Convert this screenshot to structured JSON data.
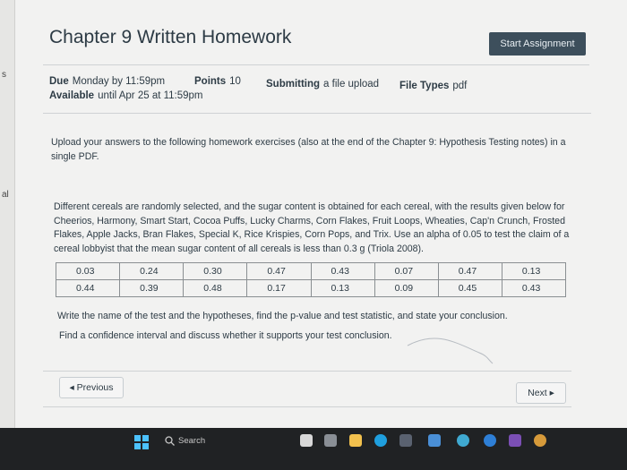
{
  "page": {
    "title": "Chapter 9 Written Homework",
    "start_button": "Start Assignment"
  },
  "rail": {
    "marks": [
      "s",
      "al"
    ]
  },
  "meta": {
    "due_label": "Due",
    "due_value": "Monday by 11:59pm",
    "points_label": "Points",
    "points_value": "10",
    "submitting_label": "Submitting",
    "submitting_value": "a file upload",
    "filetypes_label": "File Types",
    "filetypes_value": "pdf",
    "available_label": "Available",
    "available_value": "until Apr 25 at 11:59pm"
  },
  "instructions": "Upload your answers to the following homework exercises (also at the end of the Chapter 9: Hypothesis Testing notes) in a single PDF.",
  "problem": "Different cereals are randomly selected, and the sugar content is obtained for each cereal, with the results given below for Cheerios, Harmony, Smart Start, Cocoa Puffs, Lucky Charms, Corn Flakes, Fruit Loops, Wheaties, Cap'n Crunch, Frosted Flakes, Apple Jacks, Bran Flakes, Special K, Rice Krispies, Corn Pops, and Trix. Use an alpha of 0.05 to test the claim of a cereal lobbyist that the mean sugar content of all cereals is less than 0.3 g (Triola 2008).",
  "table": {
    "rows": [
      [
        "0.03",
        "0.24",
        "0.30",
        "0.47",
        "0.43",
        "0.07",
        "0.47",
        "0.13"
      ],
      [
        "0.44",
        "0.39",
        "0.48",
        "0.17",
        "0.13",
        "0.09",
        "0.45",
        "0.43"
      ]
    ]
  },
  "question1": "Write the name of the test and the hypotheses, find the p-value and test statistic, and state your conclusion.",
  "question2": "Find a confidence interval and discuss whether it supports your test conclusion.",
  "nav": {
    "previous": "◂ Previous",
    "next": "Next ▸"
  },
  "taskbar": {
    "search_placeholder": "Search",
    "colors": {
      "taskbar_bg": "#202224",
      "start_blue": "#4cc2ff"
    }
  }
}
